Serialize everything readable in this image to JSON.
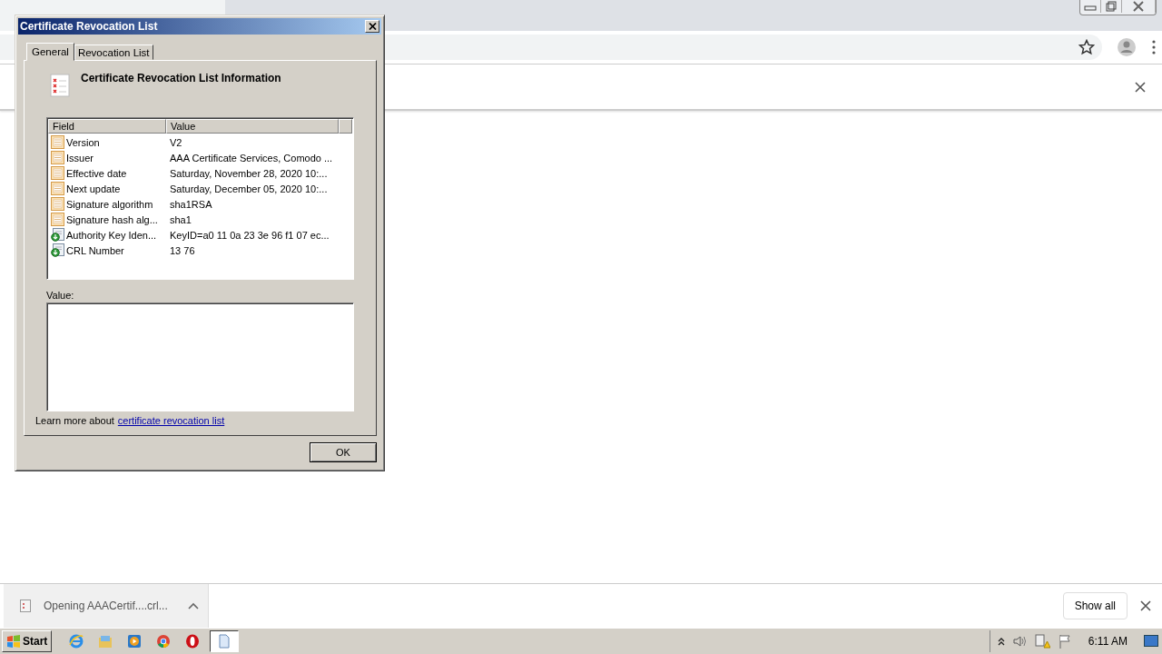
{
  "browser": {
    "download": {
      "label": "Opening AAACertif....crl...",
      "show_all": "Show all"
    }
  },
  "dialog": {
    "title": "Certificate Revocation List",
    "tabs": [
      {
        "label": "General",
        "selected": true
      },
      {
        "label": "Revocation List",
        "selected": false
      }
    ],
    "heading": "Certificate Revocation List Information",
    "table": {
      "columns": [
        "Field",
        "Value"
      ],
      "rows": [
        {
          "kind": "text",
          "field": "Version",
          "value": "V2",
          "selected": false
        },
        {
          "kind": "text",
          "field": "Issuer",
          "value": "AAA Certificate Services, Comodo ...",
          "selected": false
        },
        {
          "kind": "text",
          "field": "Effective date",
          "value": "Saturday, November 28, 2020 10:...",
          "selected": false
        },
        {
          "kind": "text",
          "field": "Next update",
          "value": "Saturday, December 05, 2020 10:...",
          "selected": false
        },
        {
          "kind": "text",
          "field": "Signature algorithm",
          "value": "sha1RSA",
          "selected": false
        },
        {
          "kind": "text",
          "field": "Signature hash alg...",
          "value": "sha1",
          "selected": false
        },
        {
          "kind": "extension",
          "field": "Authority Key Iden...",
          "value": "KeyID=a0 11 0a 23 3e 96 f1 07 ec...",
          "selected": false
        },
        {
          "kind": "extension",
          "field": "CRL Number",
          "value": "13 76",
          "selected": false
        }
      ]
    },
    "value_label": "Value:",
    "learn_more": {
      "text": "Learn more about",
      "link": "certificate revocation list"
    },
    "ok": "OK"
  },
  "taskbar": {
    "start": "Start",
    "apps": [
      {
        "kind": "ie",
        "selected": false
      },
      {
        "kind": "folder",
        "selected": false
      },
      {
        "kind": "media",
        "selected": false
      },
      {
        "kind": "chrome",
        "selected": false
      },
      {
        "kind": "opera",
        "selected": false
      },
      {
        "kind": "document",
        "selected": true
      }
    ],
    "clock": "6:11 AM"
  }
}
